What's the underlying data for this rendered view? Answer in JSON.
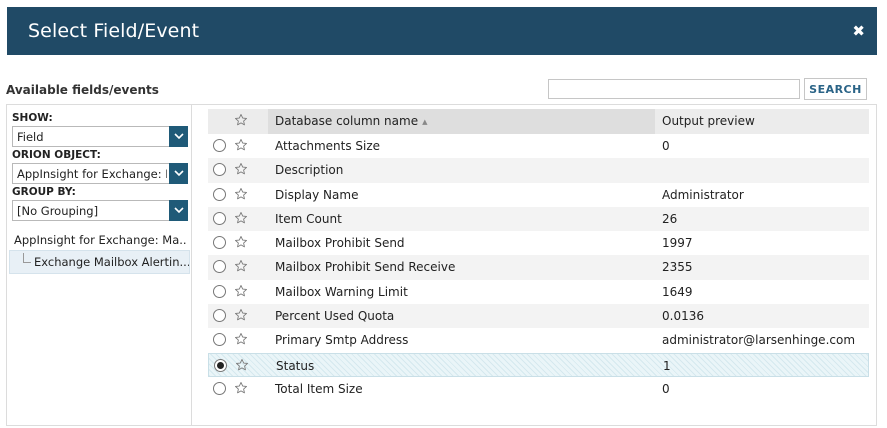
{
  "dialog": {
    "title": "Select Field/Event",
    "close_glyph": "✖"
  },
  "available_label": "Available fields/events",
  "search": {
    "value": "",
    "placeholder": "",
    "button_label": "SEARCH"
  },
  "filters": {
    "show": {
      "label": "SHOW:",
      "value": "Field"
    },
    "orion_object": {
      "label": "ORION OBJECT:",
      "value": "AppInsight for Exchange: M"
    },
    "group_by": {
      "label": "GROUP BY:",
      "value": "[No Grouping]"
    }
  },
  "tree": {
    "root": "AppInsight for Exchange: Ma...",
    "child": "Exchange Mailbox Alertin..."
  },
  "grid": {
    "columns": {
      "name": "Database column name",
      "output": "Output preview"
    },
    "rows": [
      {
        "name": "Attachments Size",
        "output": "0",
        "selected": false
      },
      {
        "name": "Description",
        "output": "",
        "selected": false
      },
      {
        "name": "Display Name",
        "output": "Administrator",
        "selected": false
      },
      {
        "name": "Item Count",
        "output": "26",
        "selected": false
      },
      {
        "name": "Mailbox Prohibit Send",
        "output": "1997",
        "selected": false
      },
      {
        "name": "Mailbox Prohibit Send Receive",
        "output": "2355",
        "selected": false
      },
      {
        "name": "Mailbox Warning Limit",
        "output": "1649",
        "selected": false
      },
      {
        "name": "Percent Used Quota",
        "output": "0.0136",
        "selected": false
      },
      {
        "name": "Primary Smtp Address",
        "output": "administrator@larsenhinge.com",
        "selected": false
      },
      {
        "name": "Status",
        "output": "1",
        "selected": true
      },
      {
        "name": "Total Item Size",
        "output": "0",
        "selected": false
      }
    ]
  },
  "colors": {
    "titlebar": "#204a66",
    "accent": "#1f5a78",
    "search_text": "#2b6487"
  },
  "icons": {
    "close": "close-icon",
    "star": "star-outline-icon",
    "dropdown": "chevron-down-icon",
    "sort": "sort-ascending-icon"
  }
}
